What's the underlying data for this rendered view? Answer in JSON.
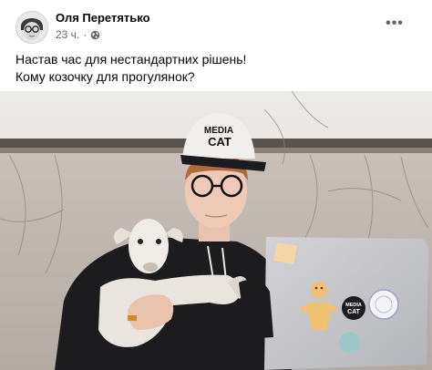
{
  "post": {
    "author": "Оля Перетятько",
    "time": "23 ч.",
    "separator": "·",
    "privacy_icon": "globe-icon",
    "more_icon": "more-options-icon",
    "more_label": "•••",
    "text_line1": "Настав час для нестандартних рішень!",
    "text_line2": "Кому козочку для прогулянок?"
  },
  "photo": {
    "cap_logo_top": "MEDIA",
    "cap_logo_bottom": "CAT",
    "sticker_top": "MEDIA",
    "sticker_bottom": "CAT"
  },
  "colors": {
    "author_text": "#050505",
    "meta_text": "#65676b",
    "background": "#f0f2f5"
  }
}
